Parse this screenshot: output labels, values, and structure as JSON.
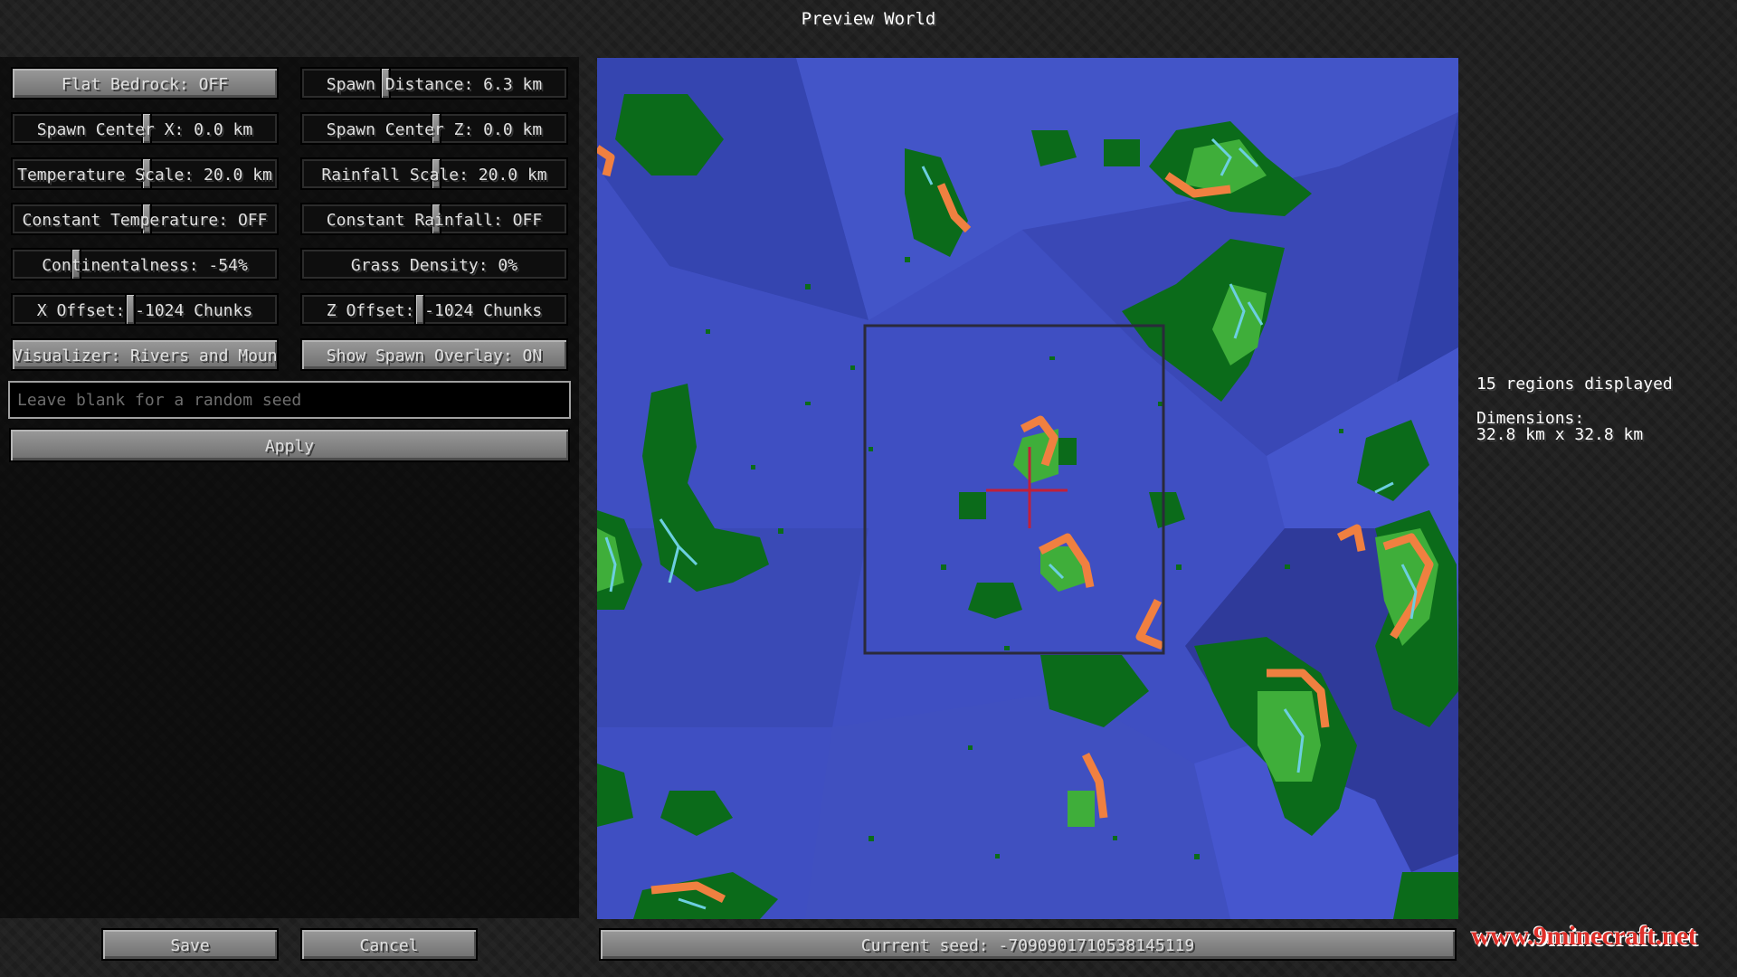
{
  "window": {
    "title": "Preview World"
  },
  "settings": {
    "flat_bedrock": "Flat Bedrock: OFF",
    "spawn_distance": "Spawn Distance: 6.3 km",
    "spawn_center_x": "Spawn Center X: 0.0 km",
    "spawn_center_z": "Spawn Center Z: 0.0 km",
    "temperature_scale": "Temperature Scale: 20.0 km",
    "rainfall_scale": "Rainfall Scale: 20.0 km",
    "constant_temperature": "Constant Temperature: OFF",
    "constant_rainfall": "Constant Rainfall: OFF",
    "continentalness": "Continentalness: -54%",
    "grass_density": "Grass Density: 0%",
    "x_offset": "X Offset: -1024 Chunks",
    "z_offset": "Z Offset: -1024 Chunks",
    "visualizer": "Visualizer: Rivers and Mountains",
    "show_spawn_overlay": "Show Spawn Overlay: ON"
  },
  "seed": {
    "placeholder": "Leave blank for a random seed",
    "value": ""
  },
  "actions": {
    "apply": "Apply",
    "save": "Save",
    "cancel": "Cancel"
  },
  "info": {
    "regions": "15 regions displayed",
    "dimensions_label": "Dimensions:",
    "dimensions_value": "32.8 km x 32.8 km"
  },
  "status": {
    "current_seed": "Current seed: -7090901710538145119"
  },
  "watermark": "www.9minecraft.net",
  "colors": {
    "ocean": "#3f4fc2",
    "deep_ocean": "#303a9e",
    "land": "#0b6b1a",
    "lowland": "#3fae3a",
    "river": "#6ccfe0",
    "mountain": "#f08040",
    "spawn_marker": "#c0203a"
  }
}
